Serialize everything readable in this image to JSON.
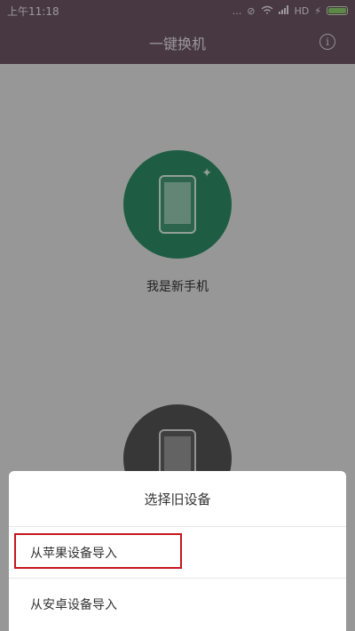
{
  "status_bar": {
    "time": "上午11:18",
    "dots": "...",
    "signal": "HD"
  },
  "header": {
    "title": "一键换机",
    "info_icon": "info-icon"
  },
  "main": {
    "new_phone_label": "我是新手机"
  },
  "bottom_sheet": {
    "title": "选择旧设备",
    "options": [
      {
        "label": "从苹果设备导入"
      },
      {
        "label": "从安卓设备导入"
      }
    ]
  }
}
